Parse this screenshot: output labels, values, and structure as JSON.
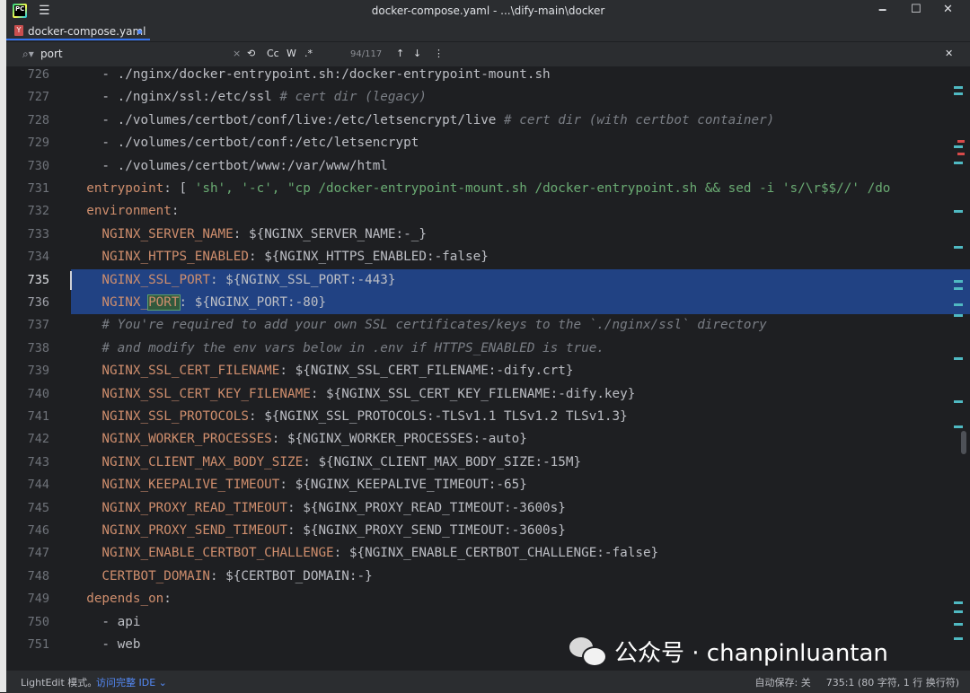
{
  "window": {
    "title": "docker-compose.yaml - ...\\dify-main\\docker",
    "logo": "PC",
    "minimize_glyph": "🗕",
    "maximize_glyph": "☐",
    "close_glyph": "✕"
  },
  "tab": {
    "label": "docker-compose.yaml",
    "icon_text": "Y"
  },
  "find": {
    "query": "port",
    "clear_glyph": "×",
    "regex_refresh_glyph": "⟲",
    "match_case_label": "Cc",
    "whole_word_label": "W",
    "regex_label": ".*",
    "match_count": "94/117",
    "prev_glyph": "↑",
    "next_glyph": "↓",
    "more_glyph": "⋮",
    "close_glyph": "✕"
  },
  "editor": {
    "lines": [
      {
        "num": "726",
        "text": "    - ./nginx/docker-entrypoint.sh:/docker-entrypoint-mount.sh"
      },
      {
        "num": "727",
        "text": "    - ./nginx/ssl:/etc/ssl ",
        "comment": "# cert dir (legacy)"
      },
      {
        "num": "728",
        "text": "    - ./volumes/certbot/conf/live:/etc/letsencrypt/live ",
        "comment": "# cert dir (with certbot container)"
      },
      {
        "num": "729",
        "text": "    - ./volumes/certbot/conf:/etc/letsencrypt"
      },
      {
        "num": "730",
        "text": "    - ./volumes/certbot/www:/var/www/html"
      },
      {
        "num": "731",
        "key": "  entrypoint",
        "rest": ": [ ",
        "str": "'sh', '-c', \"cp /docker-entrypoint-mount.sh /docker-entrypoint.sh && sed -i 's/\\r$$//' /do"
      },
      {
        "num": "732",
        "key": "  environment",
        "rest": ":"
      },
      {
        "num": "733",
        "key": "    NGINX_SERVER_NAME",
        "rest": ": ${NGINX_SERVER_NAME:-_}"
      },
      {
        "num": "734",
        "key": "    NGINX_HTTPS_ENABLED",
        "rest": ": ${NGINX_HTTPS_ENABLED:-false}"
      },
      {
        "num": "735",
        "key": "    NGINX_SSL_PORT",
        "rest": ": ${NGINX_SSL_PORT:-443}",
        "selected": true,
        "current": true
      },
      {
        "num": "736",
        "key_pre": "    NGINX_",
        "key_hl": "PORT",
        "rest": ": ${NGINX_PORT:-80}",
        "selected": true
      },
      {
        "num": "737",
        "comment": "    # You're required to add your own SSL certificates/keys to the `./nginx/ssl` directory"
      },
      {
        "num": "738",
        "comment": "    # and modify the env vars below in .env if HTTPS_ENABLED is true."
      },
      {
        "num": "739",
        "key": "    NGINX_SSL_CERT_FILENAME",
        "rest": ": ${NGINX_SSL_CERT_FILENAME:-dify.crt}"
      },
      {
        "num": "740",
        "key": "    NGINX_SSL_CERT_KEY_FILENAME",
        "rest": ": ${NGINX_SSL_CERT_KEY_FILENAME:-dify.key}"
      },
      {
        "num": "741",
        "key": "    NGINX_SSL_PROTOCOLS",
        "rest": ": ${NGINX_SSL_PROTOCOLS:-TLSv1.1 TLSv1.2 TLSv1.3}"
      },
      {
        "num": "742",
        "key": "    NGINX_WORKER_PROCESSES",
        "rest": ": ${NGINX_WORKER_PROCESSES:-auto}"
      },
      {
        "num": "743",
        "key": "    NGINX_CLIENT_MAX_BODY_SIZE",
        "rest": ": ${NGINX_CLIENT_MAX_BODY_SIZE:-15M}"
      },
      {
        "num": "744",
        "key": "    NGINX_KEEPALIVE_TIMEOUT",
        "rest": ": ${NGINX_KEEPALIVE_TIMEOUT:-65}"
      },
      {
        "num": "745",
        "key": "    NGINX_PROXY_READ_TIMEOUT",
        "rest": ": ${NGINX_PROXY_READ_TIMEOUT:-3600s}"
      },
      {
        "num": "746",
        "key": "    NGINX_PROXY_SEND_TIMEOUT",
        "rest": ": ${NGINX_PROXY_SEND_TIMEOUT:-3600s}"
      },
      {
        "num": "747",
        "key": "    NGINX_ENABLE_CERTBOT_CHALLENGE",
        "rest": ": ${NGINX_ENABLE_CERTBOT_CHALLENGE:-false}"
      },
      {
        "num": "748",
        "key": "    CERTBOT_DOMAIN",
        "rest": ": ${CERTBOT_DOMAIN:-}"
      },
      {
        "num": "749",
        "key": "  depends_on",
        "rest": ":"
      },
      {
        "num": "750",
        "text": "    - api"
      },
      {
        "num": "751",
        "text": "    - web"
      }
    ]
  },
  "watermark": {
    "text": "公众号 · chanpinluantan"
  },
  "status": {
    "mode": "LightEdit 模式。",
    "link": "访问完整 IDE ⌄",
    "autosave": "自动保存: 关",
    "position": "735:1 (80 字符, 1 行 换行符)"
  }
}
